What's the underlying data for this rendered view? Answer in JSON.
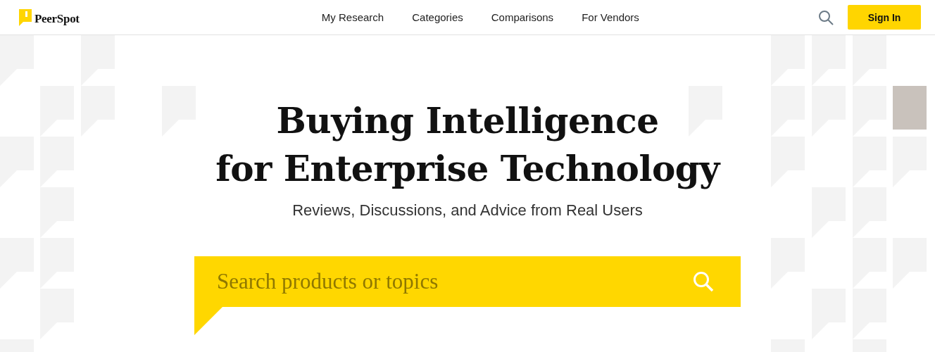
{
  "header": {
    "logo": "PeerSpot",
    "nav": [
      "My Research",
      "Categories",
      "Comparisons",
      "For Vendors"
    ],
    "sign_in": "Sign In"
  },
  "hero": {
    "title_lines": [
      "Buying Intelligence",
      "for Enterprise Technology"
    ],
    "subtitle": "Reviews, Discussions, and Advice from Real Users"
  },
  "search": {
    "placeholder": "Search products or topics"
  }
}
